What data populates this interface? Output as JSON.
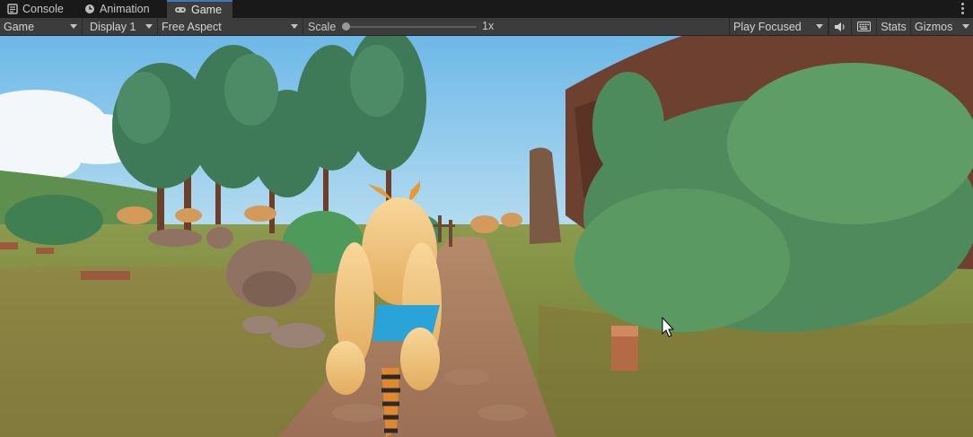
{
  "tabs": [
    {
      "label": "Console",
      "icon": "console-icon",
      "active": false
    },
    {
      "label": "Animation",
      "icon": "clock-icon",
      "active": false
    },
    {
      "label": "Game",
      "icon": "gamepad-icon",
      "active": true
    }
  ],
  "toolbar": {
    "view_mode": "Game",
    "display": "Display 1",
    "aspect": "Free Aspect",
    "scale_label": "Scale",
    "scale_value": "1x",
    "play_mode": "Play Focused",
    "audio_icon": "speaker-icon",
    "keyboard_icon": "keyboard-icon",
    "stats_label": "Stats",
    "gizmos_label": "Gizmos"
  },
  "colors": {
    "accent": "#3a79bb",
    "toolbar_bg": "#3c3c3c",
    "tabbar_bg": "#191919"
  }
}
